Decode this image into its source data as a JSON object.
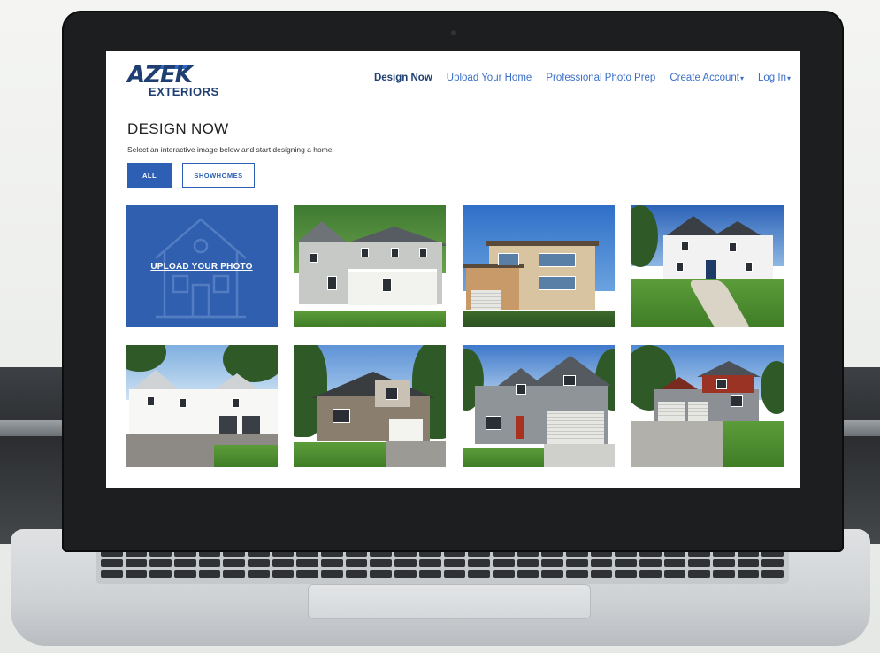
{
  "header": {
    "logo_main": "AZEK",
    "logo_sub": "EXTERIORS",
    "nav": [
      {
        "label": "Design Now",
        "active": true,
        "dropdown": false
      },
      {
        "label": "Upload Your Home",
        "active": false,
        "dropdown": false
      },
      {
        "label": "Professional Photo Prep",
        "active": false,
        "dropdown": false
      },
      {
        "label": "Create Account",
        "active": false,
        "dropdown": true
      },
      {
        "label": "Log In",
        "active": false,
        "dropdown": true
      }
    ]
  },
  "main": {
    "title": "DESIGN NOW",
    "subtitle": "Select an interactive image below and start designing a home.",
    "filters": {
      "all_label": "ALL",
      "showhomes_label": "SHOWHOMES"
    },
    "upload_label": "UPLOAD YOUR PHOTO",
    "homes": [
      {
        "style": "gray-siding-porch"
      },
      {
        "style": "modern-beige"
      },
      {
        "style": "white-gable-blue-sky"
      },
      {
        "style": "white-farmhouse"
      },
      {
        "style": "stone-craftsman"
      },
      {
        "style": "gray-garage-craftsman"
      },
      {
        "style": "red-accent-two-story"
      }
    ]
  },
  "colors": {
    "brand_blue": "#2d5fb4",
    "logo_navy": "#1f3f73",
    "nav_blue": "#3b6fc7",
    "upload_tile": "#2f5fae"
  },
  "icons": {
    "upload_tile_icon": "house-outline-icon",
    "nav_caret": "caret-down-icon"
  }
}
